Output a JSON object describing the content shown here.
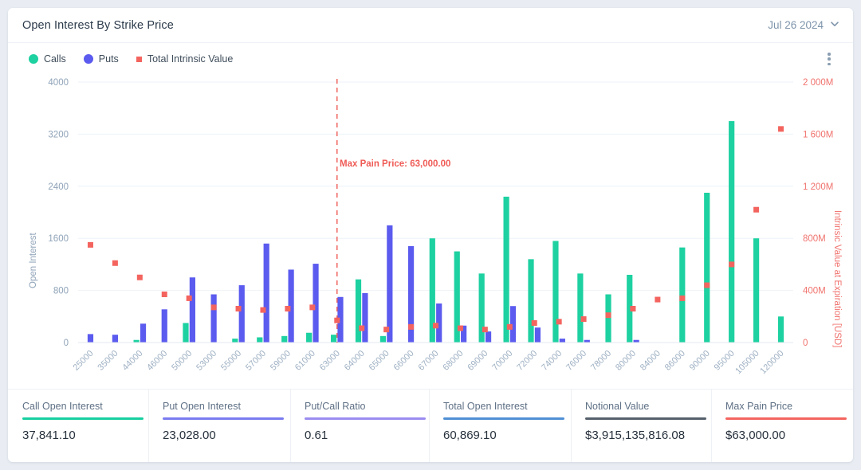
{
  "header": {
    "title": "Open Interest By Strike Price",
    "date": "Jul 26 2024",
    "chevron_icon": "chevron-down-icon",
    "menu_icon": "kebab-menu-icon"
  },
  "legend": [
    {
      "label": "Calls",
      "color": "#1dd1a1",
      "marker": "circle"
    },
    {
      "label": "Puts",
      "color": "#5b5bef",
      "marker": "circle"
    },
    {
      "label": "Total Intrinsic Value",
      "color": "#f4645f",
      "marker": "square"
    }
  ],
  "annotation": {
    "max_pain_text": "Max Pain Price: 63,000.00",
    "max_pain_strike": "63000",
    "line_color": "#ef5b56"
  },
  "stats": [
    {
      "label": "Call Open Interest",
      "value": "37,841.10",
      "color": "#17cfa0"
    },
    {
      "label": "Put Open Interest",
      "value": "23,028.00",
      "color": "#7b7bf0"
    },
    {
      "label": "Put/Call Ratio",
      "value": "0.61",
      "color": "#9b8cf0"
    },
    {
      "label": "Total Open Interest",
      "value": "60,869.10",
      "color": "#4f8fd4"
    },
    {
      "label": "Notional Value",
      "value": "$3,915,135,816.08",
      "color": "#55606b"
    },
    {
      "label": "Max Pain Price",
      "value": "$63,000.00",
      "color": "#f4645f"
    }
  ],
  "chart_data": {
    "type": "bar",
    "title": "Open Interest By Strike Price",
    "xlabel": "",
    "ylabel": "Open Interest",
    "y2label": "Intrinsic Value at Expiration [USD]",
    "ylim": [
      0,
      4000
    ],
    "yticks": [
      "0",
      "800",
      "1600",
      "2400",
      "3200",
      "4000"
    ],
    "y2lim": [
      0,
      2000000000
    ],
    "y2ticks": [
      "0",
      "400M",
      "800M",
      "1 200M",
      "1 600M",
      "2 000M"
    ],
    "grid": true,
    "legend_position": "top-left",
    "categories": [
      "25000",
      "35000",
      "44000",
      "46000",
      "50000",
      "53000",
      "55000",
      "57000",
      "59000",
      "61000",
      "63000",
      "64000",
      "65000",
      "66000",
      "67000",
      "68000",
      "69000",
      "70000",
      "72000",
      "74000",
      "76000",
      "78000",
      "80000",
      "84000",
      "86000",
      "90000",
      "95000",
      "105000",
      "120000"
    ],
    "series": [
      {
        "name": "Calls",
        "color": "#1dd1a1",
        "axis": "left",
        "values": [
          0,
          0,
          40,
          0,
          300,
          0,
          60,
          80,
          100,
          150,
          120,
          970,
          100,
          0,
          1600,
          1400,
          1060,
          2240,
          1280,
          1560,
          1060,
          740,
          1040,
          0,
          1460,
          2300,
          3400,
          1600,
          400
        ]
      },
      {
        "name": "Puts",
        "color": "#5b5bef",
        "axis": "left",
        "values": [
          130,
          120,
          290,
          510,
          1000,
          740,
          880,
          1520,
          1120,
          1210,
          700,
          760,
          1800,
          1480,
          600,
          260,
          170,
          560,
          230,
          60,
          40,
          0,
          40,
          0,
          0,
          0,
          0,
          0,
          0
        ]
      },
      {
        "name": "Total Intrinsic Value",
        "color": "#f4645f",
        "axis": "right",
        "marker": "square",
        "values": [
          750000000,
          610000000,
          500000000,
          370000000,
          340000000,
          270000000,
          260000000,
          250000000,
          260000000,
          270000000,
          170000000,
          110000000,
          100000000,
          120000000,
          130000000,
          110000000,
          100000000,
          120000000,
          150000000,
          160000000,
          180000000,
          210000000,
          260000000,
          330000000,
          340000000,
          440000000,
          600000000,
          1020000000,
          1640000000
        ]
      }
    ],
    "bars_detail": [
      {
        "strike": "25000",
        "calls": 0,
        "puts": 130,
        "iv": 750000000
      },
      {
        "strike": "35000",
        "calls": 0,
        "puts": 120,
        "iv": 610000000
      },
      {
        "strike": "44000",
        "calls": 40,
        "puts": 290,
        "iv": 500000000
      },
      {
        "strike": "46000",
        "calls": 0,
        "puts": 510,
        "iv": 370000000
      },
      {
        "strike": "50000",
        "calls": 300,
        "puts": 1000,
        "iv": 340000000
      },
      {
        "strike": "53000",
        "calls": 0,
        "puts": 740,
        "iv": 270000000
      },
      {
        "strike": "55000",
        "calls": 60,
        "puts": 880,
        "iv": 260000000
      },
      {
        "strike": "57000",
        "calls": 80,
        "puts": 1520,
        "iv": 250000000
      },
      {
        "strike": "59000",
        "calls": 100,
        "puts": 1120,
        "iv": 260000000
      },
      {
        "strike": "61000",
        "calls": 150,
        "puts": 1210,
        "iv": 270000000
      },
      {
        "strike": "63000",
        "calls": 120,
        "puts": 700,
        "iv": 170000000
      },
      {
        "strike": "64000",
        "calls": 970,
        "puts": 760,
        "iv": 110000000
      },
      {
        "strike": "65000",
        "calls": 100,
        "puts": 1800,
        "iv": 100000000
      },
      {
        "strike": "66000",
        "calls": 0,
        "puts": 1480,
        "iv": 120000000
      },
      {
        "strike": "67000",
        "calls": 1600,
        "puts": 600,
        "iv": 130000000
      },
      {
        "strike": "68000",
        "calls": 1400,
        "puts": 260,
        "iv": 110000000
      },
      {
        "strike": "69000",
        "calls": 1060,
        "puts": 170,
        "iv": 100000000
      },
      {
        "strike": "70000",
        "calls": 2240,
        "puts": 560,
        "iv": 120000000
      },
      {
        "strike": "72000",
        "calls": 1280,
        "puts": 230,
        "iv": 150000000
      },
      {
        "strike": "74000",
        "calls": 1560,
        "puts": 60,
        "iv": 160000000
      },
      {
        "strike": "76000",
        "calls": 1060,
        "puts": 40,
        "iv": 180000000
      },
      {
        "strike": "78000",
        "calls": 740,
        "puts": 0,
        "iv": 210000000
      },
      {
        "strike": "80000",
        "calls": 1040,
        "puts": 40,
        "iv": 260000000
      },
      {
        "strike": "84000",
        "calls": 0,
        "puts": 0,
        "iv": 330000000
      },
      {
        "strike": "86000",
        "calls": 1460,
        "puts": 0,
        "iv": 340000000
      },
      {
        "strike": "90000",
        "calls": 2300,
        "puts": 0,
        "iv": 440000000
      },
      {
        "strike": "95000",
        "calls": 3400,
        "puts": 0,
        "iv": 600000000
      },
      {
        "strike": "105000",
        "calls": 1600,
        "puts": 0,
        "iv": 1020000000
      },
      {
        "strike": "120000",
        "calls": 400,
        "puts": 0,
        "iv": 1640000000
      }
    ]
  }
}
